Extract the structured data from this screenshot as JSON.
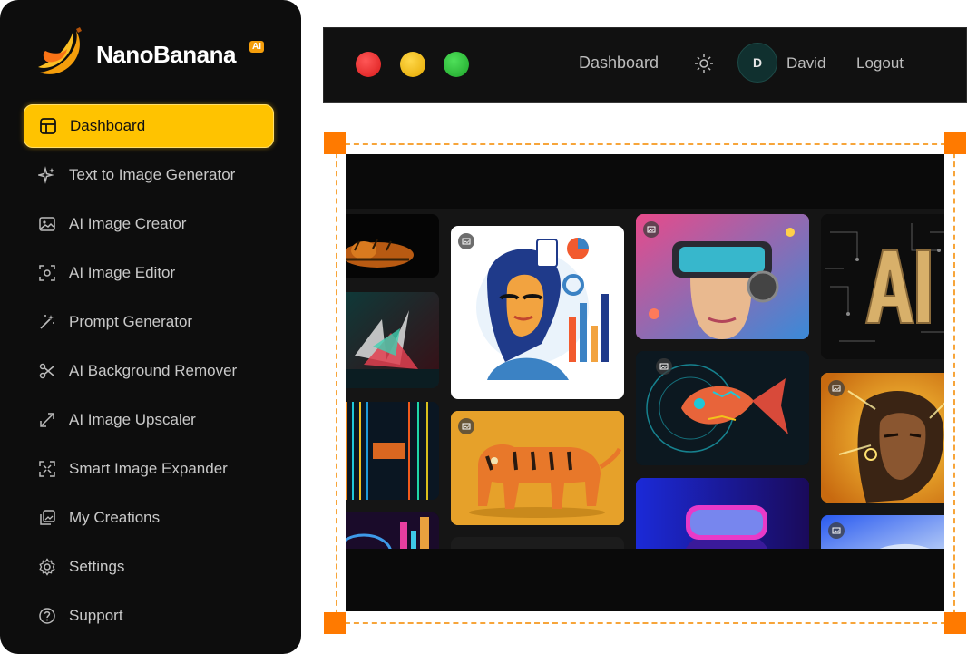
{
  "brand": {
    "name": "NanoBanana",
    "badge": "AI",
    "accent": "#ffc300",
    "logo_icon": "banana-logo-icon"
  },
  "sidebar": {
    "items": [
      {
        "label": "Dashboard",
        "icon": "layout-icon",
        "active": true
      },
      {
        "label": "Text to Image Generator",
        "icon": "sparkles-icon",
        "active": false
      },
      {
        "label": "AI Image Creator",
        "icon": "image-icon",
        "active": false
      },
      {
        "label": "AI Image Editor",
        "icon": "focus-icon",
        "active": false
      },
      {
        "label": "Prompt Generator",
        "icon": "magic-wand-icon",
        "active": false
      },
      {
        "label": "AI Background Remover",
        "icon": "scissors-icon",
        "active": false
      },
      {
        "label": "AI Image Upscaler",
        "icon": "expand-arrows-icon",
        "active": false
      },
      {
        "label": "Smart Image Expander",
        "icon": "expand-frame-icon",
        "active": false
      },
      {
        "label": "My Creations",
        "icon": "gallery-icon",
        "active": false
      },
      {
        "label": "Settings",
        "icon": "gear-icon",
        "active": false
      },
      {
        "label": "Support",
        "icon": "help-icon",
        "active": false
      }
    ]
  },
  "topbar": {
    "title": "Dashboard",
    "theme_icon": "sun-icon",
    "user": {
      "initial": "D",
      "name": "David"
    },
    "logout_label": "Logout",
    "window_dots": [
      "#e52626",
      "#f2c21b",
      "#2dbd3a"
    ]
  },
  "selection": {
    "border_color": "#f7a53a",
    "handle_color": "#ff7a00"
  },
  "gallery": {
    "tiles": [
      {
        "name": "tiger-robot-dark-thumb"
      },
      {
        "name": "abstract-explosion-thumb"
      },
      {
        "name": "digital-tunnel-thumb"
      },
      {
        "name": "neon-city-thumb"
      },
      {
        "name": "woman-data-illustration-image"
      },
      {
        "name": "mechanical-tiger-image"
      },
      {
        "name": "vr-headset-woman-image"
      },
      {
        "name": "robotic-fish-image"
      },
      {
        "name": "neon-skull-vr-image"
      },
      {
        "name": "ai-circuit-letters-image"
      },
      {
        "name": "cyborg-woman-image"
      },
      {
        "name": "blue-neon-portrait-image"
      }
    ]
  }
}
